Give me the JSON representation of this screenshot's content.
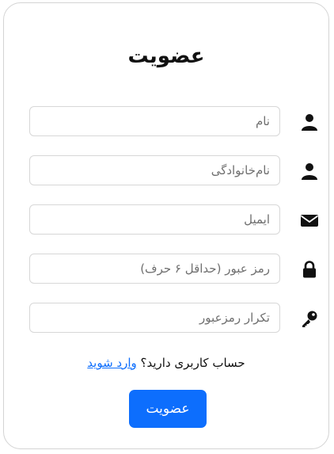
{
  "form": {
    "title": "عضویت",
    "fields": [
      {
        "placeholder": "نام",
        "value": "",
        "icon": "user-icon"
      },
      {
        "placeholder": "نام‌خانوادگی",
        "value": "",
        "icon": "user-icon"
      },
      {
        "placeholder": "ایمیل",
        "value": "",
        "icon": "envelope-icon"
      },
      {
        "placeholder": "رمز عبور (حداقل ۶ حرف)",
        "value": "",
        "icon": "lock-icon"
      },
      {
        "placeholder": "تکرار رمزعبور",
        "value": "",
        "icon": "key-icon"
      }
    ],
    "login_prompt": "حساب کاربری دارید؟",
    "login_link": "وارد شوید",
    "submit_label": "عضویت"
  },
  "colors": {
    "accent": "#0d6efd",
    "border": "#d7d7d7",
    "text": "#111111"
  }
}
